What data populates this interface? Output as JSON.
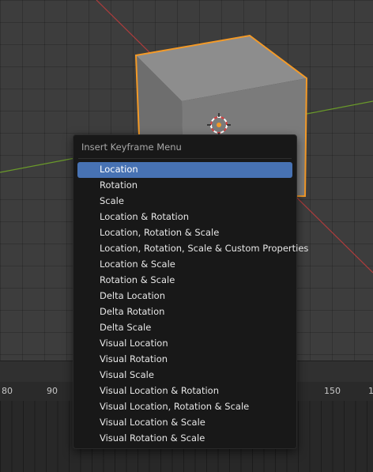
{
  "menu": {
    "title": "Insert Keyframe Menu",
    "items": [
      {
        "label": "Location",
        "active": true
      },
      {
        "label": "Rotation"
      },
      {
        "label": "Scale"
      },
      {
        "label": "Location & Rotation"
      },
      {
        "label": "Location, Rotation & Scale"
      },
      {
        "label": "Location, Rotation, Scale & Custom Properties"
      },
      {
        "label": "Location & Scale"
      },
      {
        "label": "Rotation & Scale"
      },
      {
        "label": "Delta Location"
      },
      {
        "label": "Delta Rotation"
      },
      {
        "label": "Delta Scale"
      },
      {
        "label": "Visual Location"
      },
      {
        "label": "Visual Rotation"
      },
      {
        "label": "Visual Scale"
      },
      {
        "label": "Visual Location & Rotation"
      },
      {
        "label": "Visual Location, Rotation & Scale"
      },
      {
        "label": "Visual Location & Scale"
      },
      {
        "label": "Visual Rotation & Scale"
      }
    ],
    "active_color": "#4772b3"
  },
  "timeline": {
    "ticks": [
      "80",
      "90",
      "150",
      "1"
    ]
  },
  "viewport": {
    "object_outline_color": "#f49a27",
    "x_axis_color": "#b03c3c",
    "y_axis_color": "#6a9a2a",
    "icons": [
      "3d-cursor-icon",
      "object-origin-icon"
    ]
  }
}
